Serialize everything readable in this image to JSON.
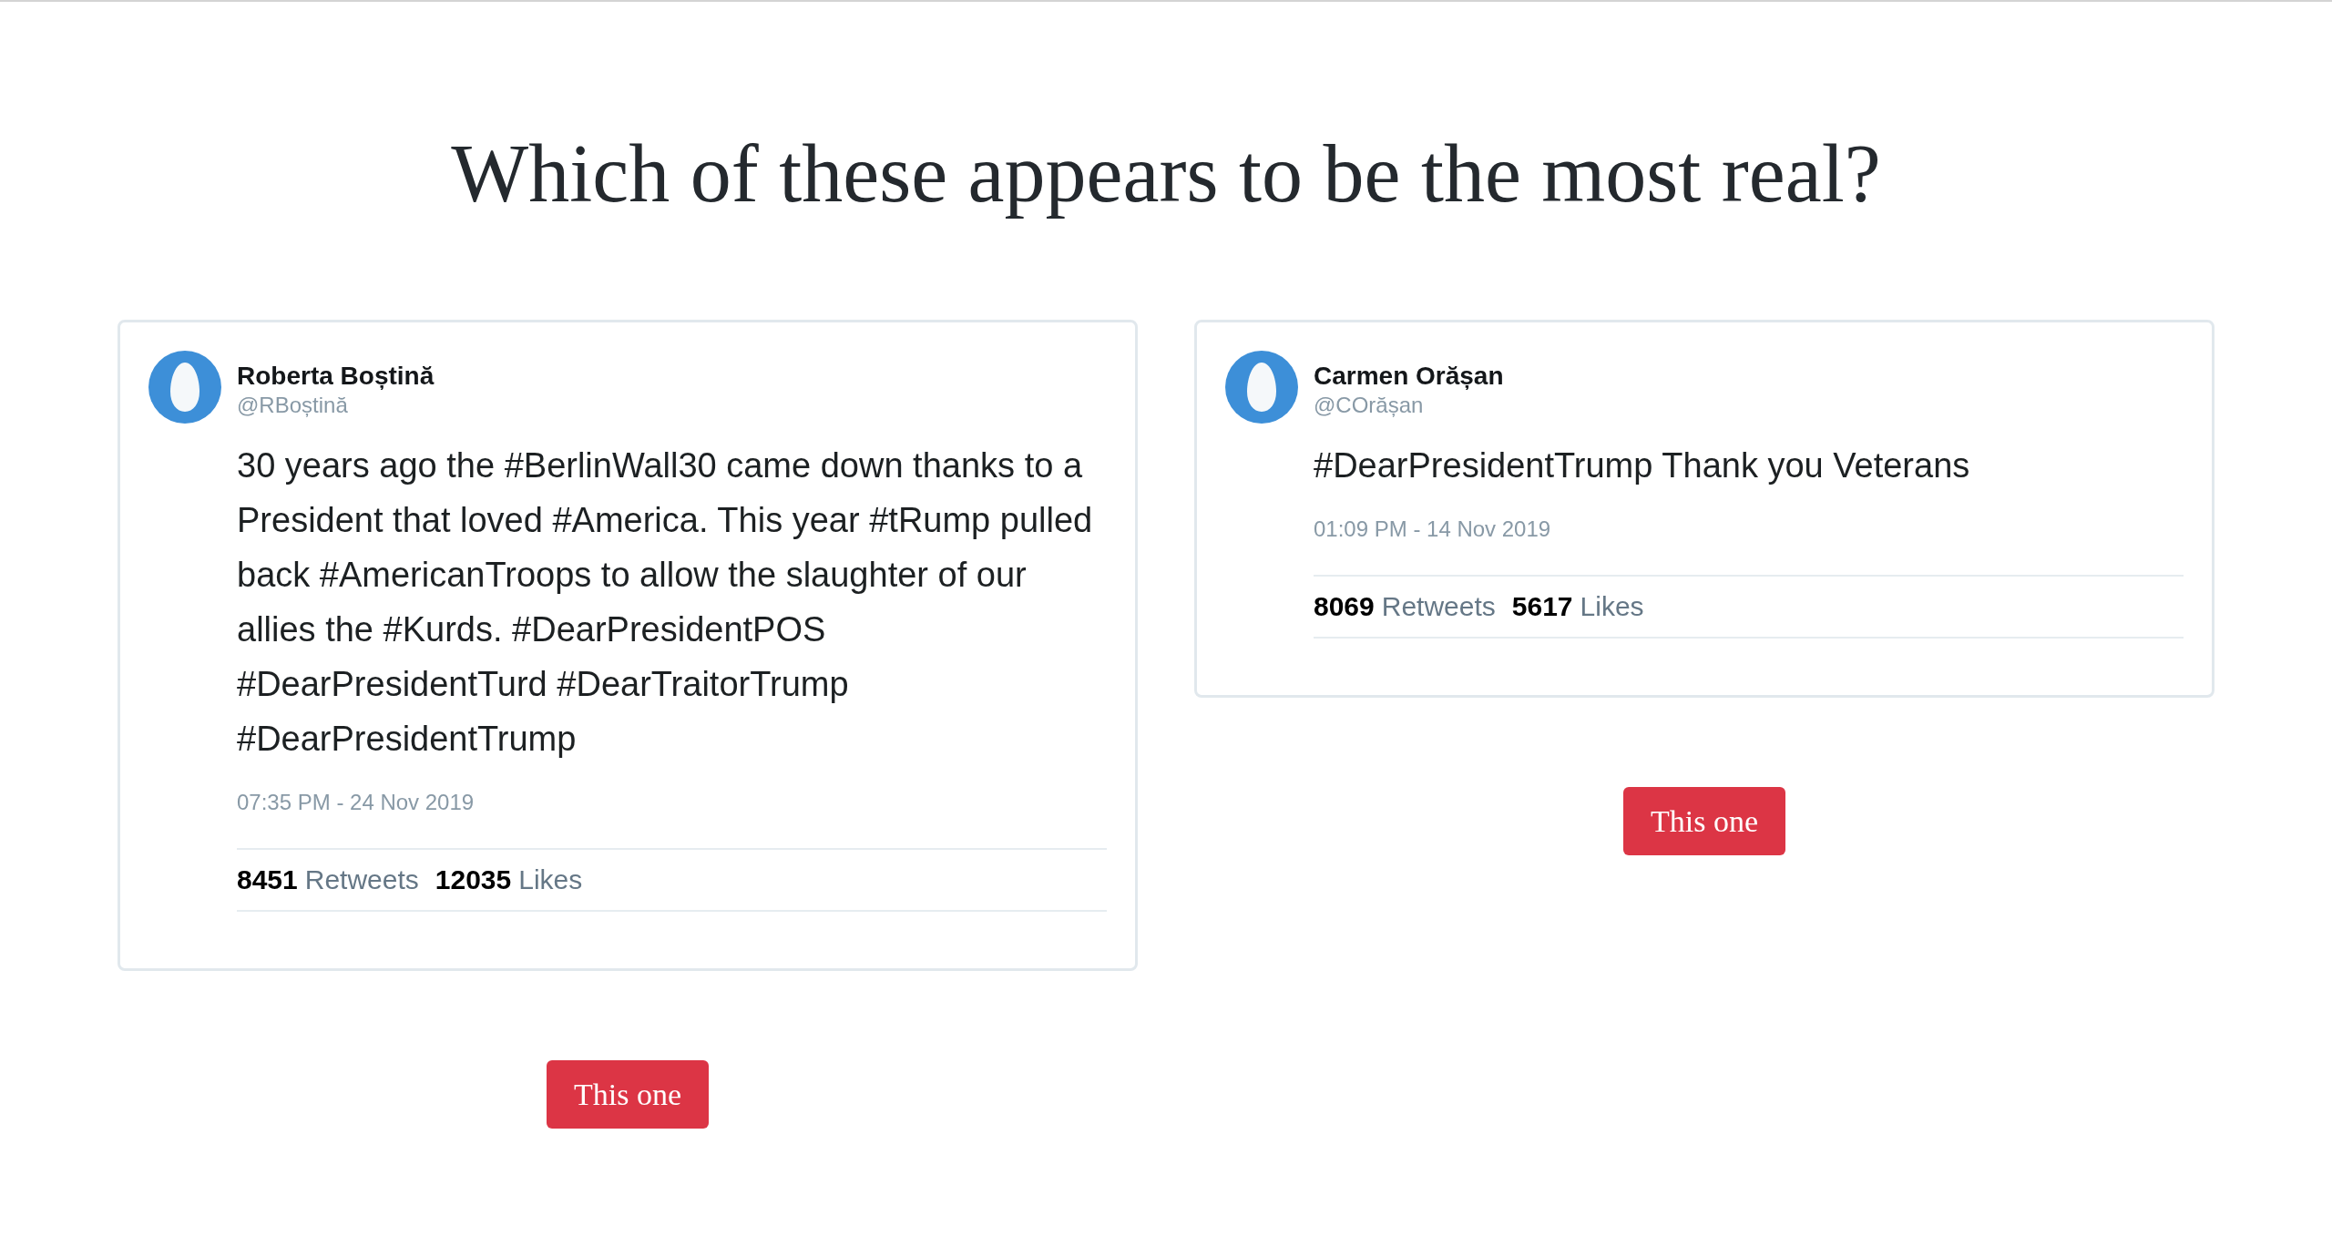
{
  "title": "Which of these appears to be the most real?",
  "options": [
    {
      "tweet": {
        "name": "Roberta Boștină",
        "handle": "@RBoștină",
        "text": "30 years ago the #BerlinWall30 came down thanks to a President that loved #America. This year #tRump pulled back #AmericanTroops to allow the slaughter of our allies the #Kurds. #DearPresidentPOS #DearPresidentTurd #DearTraitorTrump #DearPresidentTrump",
        "timestamp": "07:35 PM - 24 Nov 2019",
        "stats": [
          {
            "count": "8451",
            "label": "Retweets"
          },
          {
            "count": "12035",
            "label": "Likes"
          }
        ]
      },
      "button": "This one"
    },
    {
      "tweet": {
        "name": "Carmen Orășan",
        "handle": "@COrășan",
        "text": "#DearPresidentTrump Thank you Veterans",
        "timestamp": "01:09 PM - 14 Nov 2019",
        "stats": [
          {
            "count": "8069",
            "label": "Retweets"
          },
          {
            "count": "5617",
            "label": "Likes"
          }
        ]
      },
      "button": "This one"
    }
  ]
}
